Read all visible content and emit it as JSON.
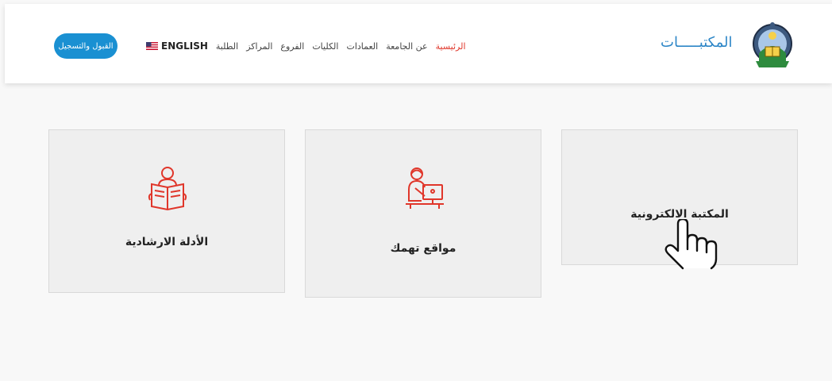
{
  "header": {
    "site_title": "المكتبـــــات",
    "register_button": "القبول والتسجيل",
    "language": "ENGLISH",
    "nav_items": [
      {
        "label": "الرئيسية",
        "active": true
      },
      {
        "label": "عن الجامعة",
        "active": false
      },
      {
        "label": "العمادات",
        "active": false
      },
      {
        "label": "الكليات",
        "active": false
      },
      {
        "label": "الفروع",
        "active": false
      },
      {
        "label": "المراكز",
        "active": false
      },
      {
        "label": "الطلبة",
        "active": false
      }
    ]
  },
  "cards": [
    {
      "label": "المكتبة الالكترونية",
      "icon": "none"
    },
    {
      "label": "مواقع تهمك",
      "icon": "person-at-computer-icon"
    },
    {
      "label": "الأدلة الارشادية",
      "icon": "person-reading-book-icon"
    }
  ],
  "colors": {
    "accent_red": "#e0362a",
    "brand_blue": "#2d86c7",
    "button_blue": "#1a90d2",
    "card_bg": "#efefef"
  },
  "cursor": "pointing-hand-cursor"
}
